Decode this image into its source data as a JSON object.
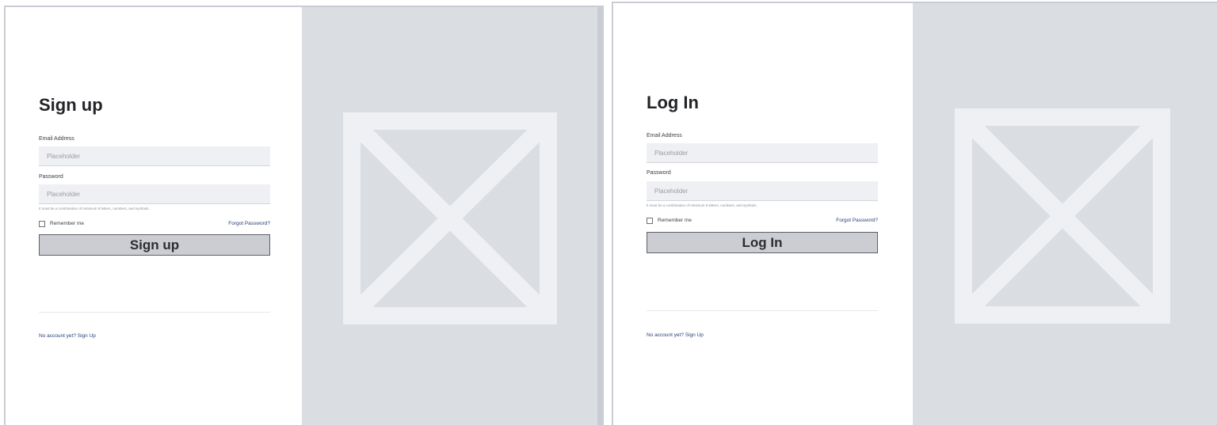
{
  "signup": {
    "title": "Sign up",
    "email_label": "Email Address",
    "email_placeholder": "Placeholder",
    "password_label": "Password",
    "password_placeholder": "Placeholder",
    "hint": "It must be a combination of minimum 8 letters, numbers, and symbols.",
    "remember_label": "Remember me",
    "forgot_label": "Forgot Password?",
    "submit_label": "Sign up",
    "footer_link": "No account yet? Sign Up",
    "image_icon": "image-placeholder-icon"
  },
  "login": {
    "title": "Log In",
    "email_label": "Email Address",
    "email_placeholder": "Placeholder",
    "password_label": "Password",
    "password_placeholder": "Placeholder",
    "hint": "It must be a combination of minimum 8 letters, numbers, and symbols.",
    "remember_label": "Remember me",
    "forgot_label": "Forgot Password?",
    "submit_label": "Log In",
    "footer_link": "No account yet? Sign Up",
    "image_icon": "image-placeholder-icon"
  },
  "colors": {
    "image_background": "#dadde2",
    "input_background": "#eff0f3",
    "button_background": "#cbcdd3",
    "link": "#2a3f7a"
  }
}
